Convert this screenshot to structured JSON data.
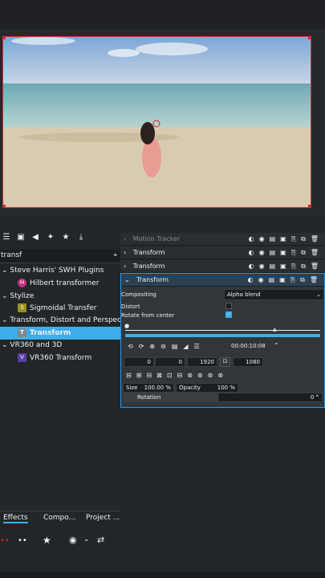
{
  "tree": {
    "search": "transf",
    "items": [
      {
        "label": "Steve Harris' SWH Plugins",
        "badge": "",
        "color": ""
      },
      {
        "label": "Hilbert transformer",
        "badge": "H",
        "color": "#c2327f"
      },
      {
        "label": "Stylize",
        "badge": "",
        "color": ""
      },
      {
        "label": "Sigmoidal Transfer",
        "badge": "S",
        "color": "#9a8f1e"
      },
      {
        "label": "Transform, Distort and Perspective",
        "badge": "",
        "color": ""
      },
      {
        "label": "Transform",
        "badge": "T",
        "color": "#7d8a92"
      },
      {
        "label": "VR360 and 3D",
        "badge": "",
        "color": ""
      },
      {
        "label": "VR360 Transform",
        "badge": "V",
        "color": "#5a3fa0"
      }
    ]
  },
  "tabs": [
    "Effects",
    "Compo...",
    "Project ..."
  ],
  "effects": [
    {
      "label": "Motion Tracker",
      "dim": true
    },
    {
      "label": "Transform",
      "dim": false
    },
    {
      "label": "Transform",
      "dim": false
    },
    {
      "label": "Transform",
      "dim": false
    }
  ],
  "params": {
    "compositing_label": "Compositing",
    "compositing_value": "Alpha blend",
    "distort_label": "Distort",
    "rotate_label": "Rotate from center",
    "timecode": "00:00:10:08",
    "x_label": "X",
    "x_value": "0",
    "y_label": "Y",
    "y_value": "0",
    "w_label": "W",
    "w_value": "1920",
    "h_label": "H",
    "h_value": "1080",
    "size_label": "Size",
    "size_value": "100.00 %",
    "opacity_label": "Opacity",
    "opacity_value": "100 %",
    "rotation_label": "Rotation",
    "rotation_value": "0 °"
  },
  "colors": {
    "accent": "#3daee9",
    "frame": "#c0392b"
  }
}
